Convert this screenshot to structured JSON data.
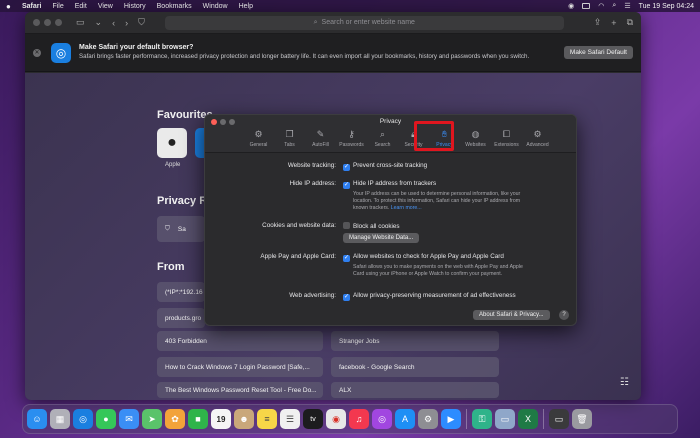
{
  "menubar": {
    "app": "Safari",
    "items": [
      "File",
      "Edit",
      "View",
      "History",
      "Bookmarks",
      "Window",
      "Help"
    ],
    "datetime": "Tue 19 Sep  04:24"
  },
  "toolbar": {
    "address_placeholder": "Search or enter website name"
  },
  "banner": {
    "title": "Make Safari your default browser?",
    "body": "Safari brings faster performance, increased privacy protection and longer battery life. It can even import all your bookmarks, history and passwords when you switch.",
    "button": "Make Safari Default"
  },
  "start_page": {
    "favourites_title": "Favourites",
    "favourites": [
      {
        "label": "Apple"
      }
    ],
    "privacy_title": "Privacy R",
    "privacy_row": "Sa",
    "frequent_title": "From",
    "frequent_items": [
      "(*IP*:*192.16",
      "products.gro",
      "403 Forbidden",
      "Stranger Jobs",
      "How to Crack Windows 7 Login Password [Safe,...",
      "facebook - Google Search",
      "The Best Windows Password Reset Tool - Free Do...",
      "ALX"
    ]
  },
  "dialog": {
    "title": "Privacy",
    "tabs": [
      {
        "label": "General",
        "icon": "gear-icon"
      },
      {
        "label": "Tabs",
        "icon": "tabs-icon"
      },
      {
        "label": "AutoFill",
        "icon": "autofill-icon"
      },
      {
        "label": "Passwords",
        "icon": "key-icon"
      },
      {
        "label": "Search",
        "icon": "search-icon"
      },
      {
        "label": "Security",
        "icon": "lock-icon"
      },
      {
        "label": "Privacy",
        "icon": "hand-icon"
      },
      {
        "label": "Websites",
        "icon": "globe-icon"
      },
      {
        "label": "Extensions",
        "icon": "puzzle-icon"
      },
      {
        "label": "Advanced",
        "icon": "gears-icon"
      }
    ],
    "active_tab": "Privacy",
    "website_tracking_label": "Website tracking:",
    "website_tracking_option": "Prevent cross-site tracking",
    "hide_ip_label": "Hide IP address:",
    "hide_ip_option": "Hide IP address from trackers",
    "hide_ip_desc": "Your IP address can be used to determine personal information, like your location. To protect this information, Safari can hide your IP address from known trackers.",
    "learn_more": "Learn more...",
    "cookies_label": "Cookies and website data:",
    "cookies_option": "Block all cookies",
    "manage_button": "Manage Website Data...",
    "applepay_label": "Apple Pay and Apple Card:",
    "applepay_option": "Allow websites to check for Apple Pay and Apple Card",
    "applepay_desc": "Safari allows you to make payments on the web with Apple Pay and Apple Card using your iPhone or Apple Watch to confirm your payment.",
    "advertising_label": "Web advertising:",
    "advertising_option": "Allow privacy-preserving measurement of ad effectiveness",
    "about_button": "About Safari & Privacy...",
    "help": "?"
  },
  "dock": {
    "apps": [
      {
        "name": "finder-icon",
        "color": "#2a8ef0"
      },
      {
        "name": "launchpad-icon",
        "color": "#b0b0b8"
      },
      {
        "name": "safari-icon",
        "color": "#1a7fe0"
      },
      {
        "name": "messages-icon",
        "color": "#35c759"
      },
      {
        "name": "mail-icon",
        "color": "#3a8ef5"
      },
      {
        "name": "maps-icon",
        "color": "#5ac36a"
      },
      {
        "name": "photos-icon",
        "color": "#f2a33a"
      },
      {
        "name": "facetime-icon",
        "color": "#2fb44a"
      },
      {
        "name": "calendar-icon",
        "color": "#f5f5f5"
      },
      {
        "name": "contacts-icon",
        "color": "#c9a77a"
      },
      {
        "name": "notes-icon",
        "color": "#f7d648"
      },
      {
        "name": "reminders-icon",
        "color": "#f0f0f0"
      },
      {
        "name": "tv-icon",
        "color": "#1c1c1e"
      },
      {
        "name": "chrome-icon",
        "color": "#e8e8e8"
      },
      {
        "name": "music-icon",
        "color": "#f3384f"
      },
      {
        "name": "podcasts-icon",
        "color": "#a146e0"
      },
      {
        "name": "appstore-icon",
        "color": "#1e8ff5"
      },
      {
        "name": "settings-icon",
        "color": "#8e8e93"
      },
      {
        "name": "zoom-icon",
        "color": "#2d8cff"
      },
      {
        "name": "vpn-icon",
        "color": "#2fb38a"
      },
      {
        "name": "preview-icon",
        "color": "#8fa7c9"
      },
      {
        "name": "excel-icon",
        "color": "#1f7a45"
      },
      {
        "name": "screen-icon",
        "color": "#3a3a3c"
      },
      {
        "name": "trash-icon",
        "color": "#9a9aa0"
      }
    ],
    "calendar_day": "19",
    "tv_label": "tv"
  }
}
